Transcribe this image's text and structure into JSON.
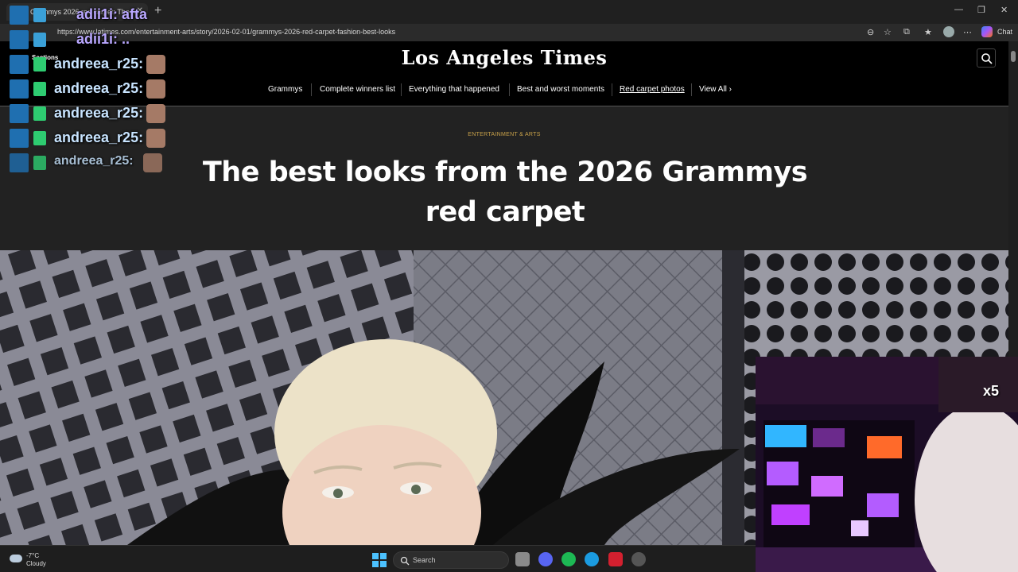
{
  "browser": {
    "tab_title": "Grammys 2026 red carpet: The b...",
    "tab_close": "✕",
    "new_tab": "+",
    "url": "https://www.latimes.com/entertainment-arts/story/2026-02-01/grammys-2026-red-carpet-fashion-best-looks",
    "chat_label": "Chat",
    "window_controls": [
      "—",
      "❐",
      "✕"
    ]
  },
  "site": {
    "masthead": "Los Angeles Times",
    "sections_label": "Sections",
    "nav": [
      {
        "label": "Grammys"
      },
      {
        "label": "Complete winners list"
      },
      {
        "label": "Everything that happened"
      },
      {
        "label": "Best and worst moments"
      },
      {
        "label": "Red carpet photos"
      },
      {
        "label": "View All ›"
      }
    ]
  },
  "article": {
    "kicker": "ENTERTAINMENT & ARTS",
    "headline": "The best looks from the 2026 Grammys red carpet"
  },
  "chat_overlay": {
    "lines": [
      {
        "name": "adii1i: afta"
      },
      {
        "name": "adii1i: .."
      },
      {
        "name": "andreea_r25:"
      },
      {
        "name": "andreea_r25:"
      },
      {
        "name": "andreea_r25:"
      },
      {
        "name": "andreea_r25:"
      },
      {
        "name": "andreea_r25:"
      }
    ]
  },
  "stream": {
    "multiplier": "x5"
  },
  "taskbar": {
    "weather_temp": "-7°C",
    "weather_condition": "Cloudy",
    "search_placeholder": "Search"
  },
  "colors": {
    "kicker": "#c9a24a",
    "header_bg": "#000000",
    "article_bg": "#222222"
  }
}
